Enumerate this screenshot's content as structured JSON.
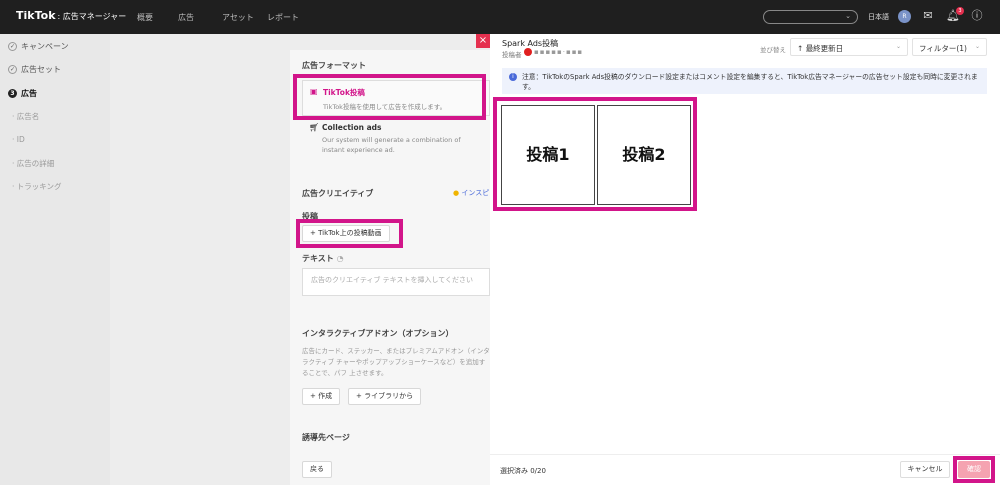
{
  "app": {
    "brand": "TikTok",
    "brand_sub": "広告マネージャー",
    "nav": [
      "概要",
      "広告",
      "アセット",
      "レポート"
    ],
    "lang": "日本語",
    "avatar": "R",
    "notification_count": "3"
  },
  "sidebar": {
    "steps": [
      "キャンペーン",
      "広告セット",
      "広告"
    ],
    "active_step_number": "3",
    "substeps": [
      "広告名",
      "ID",
      "広告の詳細",
      "トラッキング"
    ]
  },
  "main": {
    "format_title": "広告フォーマット",
    "format_tiktok": {
      "title": "TikTok投稿",
      "desc": "TikTok投稿を使用して広告を作成します。"
    },
    "format_collection": {
      "title": "Collection ads",
      "desc": "Our system will generate a combination of instant experience ad."
    },
    "creative_title": "広告クリエイティブ",
    "inspire_link": "インスピ",
    "post_label": "投稿",
    "post_button": "TikTok上の投稿動画",
    "text_label": "テキスト",
    "text_placeholder": "広告のクリエイティブ テキストを挿入してください",
    "addon_title": "インタラクティブアドオン（オプション）",
    "addon_desc": "広告にカード、ステッカー、またはプレミアムアドオン（インタラクティブ チャーやポップアップショーケースなど）を追加することで、パフ 上させます。",
    "create_button": "作成",
    "library_button": "ライブラリから",
    "destination_title": "誘導先ページ",
    "back_button": "戻る"
  },
  "drawer": {
    "title": "Spark Ads投稿",
    "poster_label": "投稿者",
    "poster_name": "▪▪▪▪▪·▪▪▪",
    "sort_label": "並び替え",
    "sort_value": "最終更新日",
    "filter_label": "フィルター(1)",
    "notice": "注意：TikTokのSpark Ads投稿のダウンロード設定またはコメント設定を編集すると、TikTok広告マネージャーの広告セット設定も同時に変更されます。",
    "posts": [
      "投稿1",
      "投稿2"
    ],
    "selected_count": "選択済み 0/20",
    "cancel_button": "キャンセル",
    "confirm_button": "確認"
  },
  "colors": {
    "highlight": "#d2158a",
    "accent": "#e5304f",
    "topbar": "#1f1f1f",
    "info": "#4a6ad9"
  }
}
